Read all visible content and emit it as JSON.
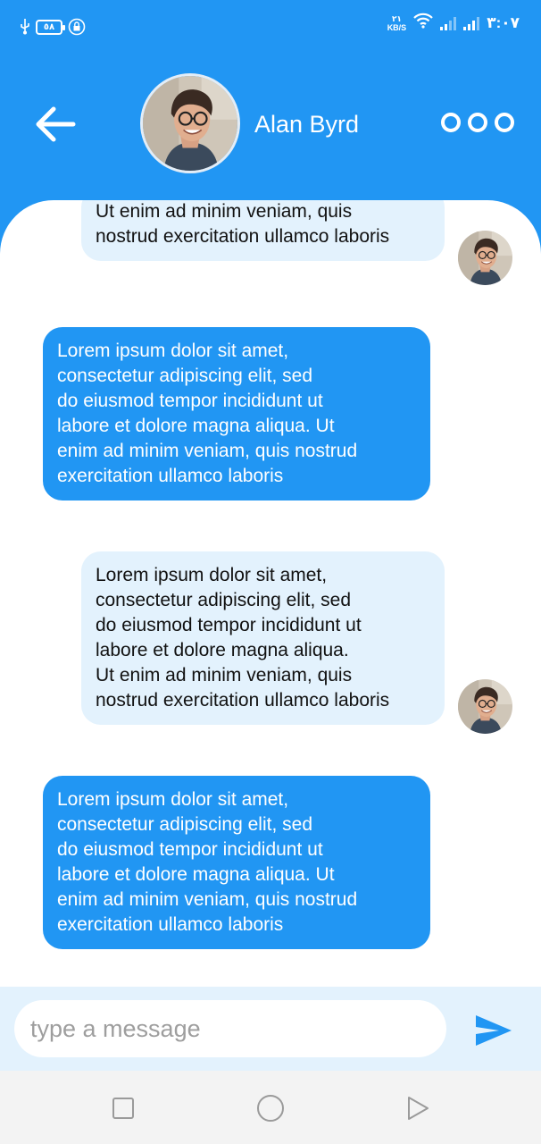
{
  "status_bar": {
    "battery_level": "٥٨",
    "net_speed_value": "٢١",
    "net_speed_unit": "KB/S",
    "time": "٣:٠٧"
  },
  "header": {
    "contact_name": "Alan Byrd"
  },
  "messages": [
    {
      "type": "outgoing",
      "lines": [
        "Ut enim ad minim veniam, quis",
        "nostrud exercitation ullamco laboris"
      ]
    },
    {
      "type": "incoming",
      "lines": [
        "Lorem ipsum dolor sit amet,",
        "consectetur adipiscing elit, sed",
        "do eiusmod tempor incididunt ut",
        "labore et dolore magna aliqua. Ut",
        "enim ad minim veniam, quis nostrud",
        "exercitation ullamco laboris"
      ]
    },
    {
      "type": "outgoing",
      "lines": [
        "Lorem ipsum dolor sit amet,",
        "consectetur adipiscing elit, sed",
        "do eiusmod tempor incididunt ut",
        "labore et dolore magna aliqua.",
        "Ut enim ad minim veniam, quis",
        "nostrud exercitation ullamco laboris"
      ]
    },
    {
      "type": "incoming",
      "lines": [
        "Lorem ipsum dolor sit amet,",
        "consectetur adipiscing elit, sed",
        "do eiusmod tempor incididunt ut",
        "labore et dolore magna aliqua. Ut",
        "enim ad minim veniam, quis nostrud",
        "exercitation ullamco laboris"
      ]
    }
  ],
  "composer": {
    "placeholder": "type a message"
  },
  "icons": {
    "back": "arrow-left-icon",
    "more": "more-options-icon",
    "send": "send-icon",
    "nav_recents": "square-icon",
    "nav_home": "circle-icon",
    "nav_back": "triangle-icon"
  },
  "colors": {
    "primary": "#2196f3",
    "outgoing_bubble": "#e3f2fd",
    "incoming_bubble": "#2196f3",
    "input_bar": "#e3f2fd",
    "nav_bar": "#f3f3f3"
  }
}
